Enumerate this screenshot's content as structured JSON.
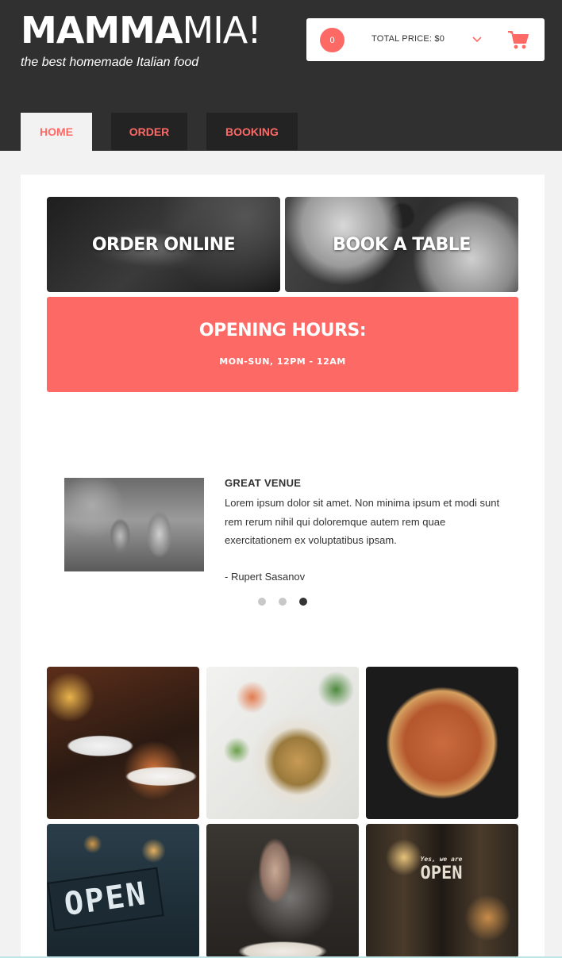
{
  "brand": {
    "name_bold": "MAMMA",
    "name_light": "MIA!",
    "tagline": "the best homemade Italian food"
  },
  "cart": {
    "count": "0",
    "total_label": "TOTAL PRICE: $0",
    "chevron_icon": "chevron-down-icon",
    "cart_icon": "shopping-cart-icon"
  },
  "nav": {
    "tabs": [
      {
        "label": "HOME",
        "active": true
      },
      {
        "label": "ORDER"
      },
      {
        "label": "BOOKING"
      }
    ]
  },
  "tiles": {
    "order_label": "ORDER ONLINE",
    "book_label": "BOOK A TABLE"
  },
  "hours": {
    "title": "OPENING HOURS:",
    "time": "MON-SUN, 12PM - 12AM"
  },
  "testimonial": {
    "title": "GREAT VENUE",
    "text": "Lorem ipsum dolor sit amet. Non minima ipsum et modi sunt rem rerum nihil qui doloremque autem rem quae exercitationem ex voluptatibus ipsam.",
    "author": "- Rupert Sasanov",
    "dots": 3,
    "active_dot": 3
  },
  "gallery": {
    "sign_text": "OPEN",
    "sign2_small": "Yes, we are",
    "sign2_text": "OPEN"
  },
  "colors": {
    "accent": "#fd6a66",
    "header_bg": "#303030",
    "tab_bg": "#232323",
    "page_bg": "#f2f2f2"
  }
}
